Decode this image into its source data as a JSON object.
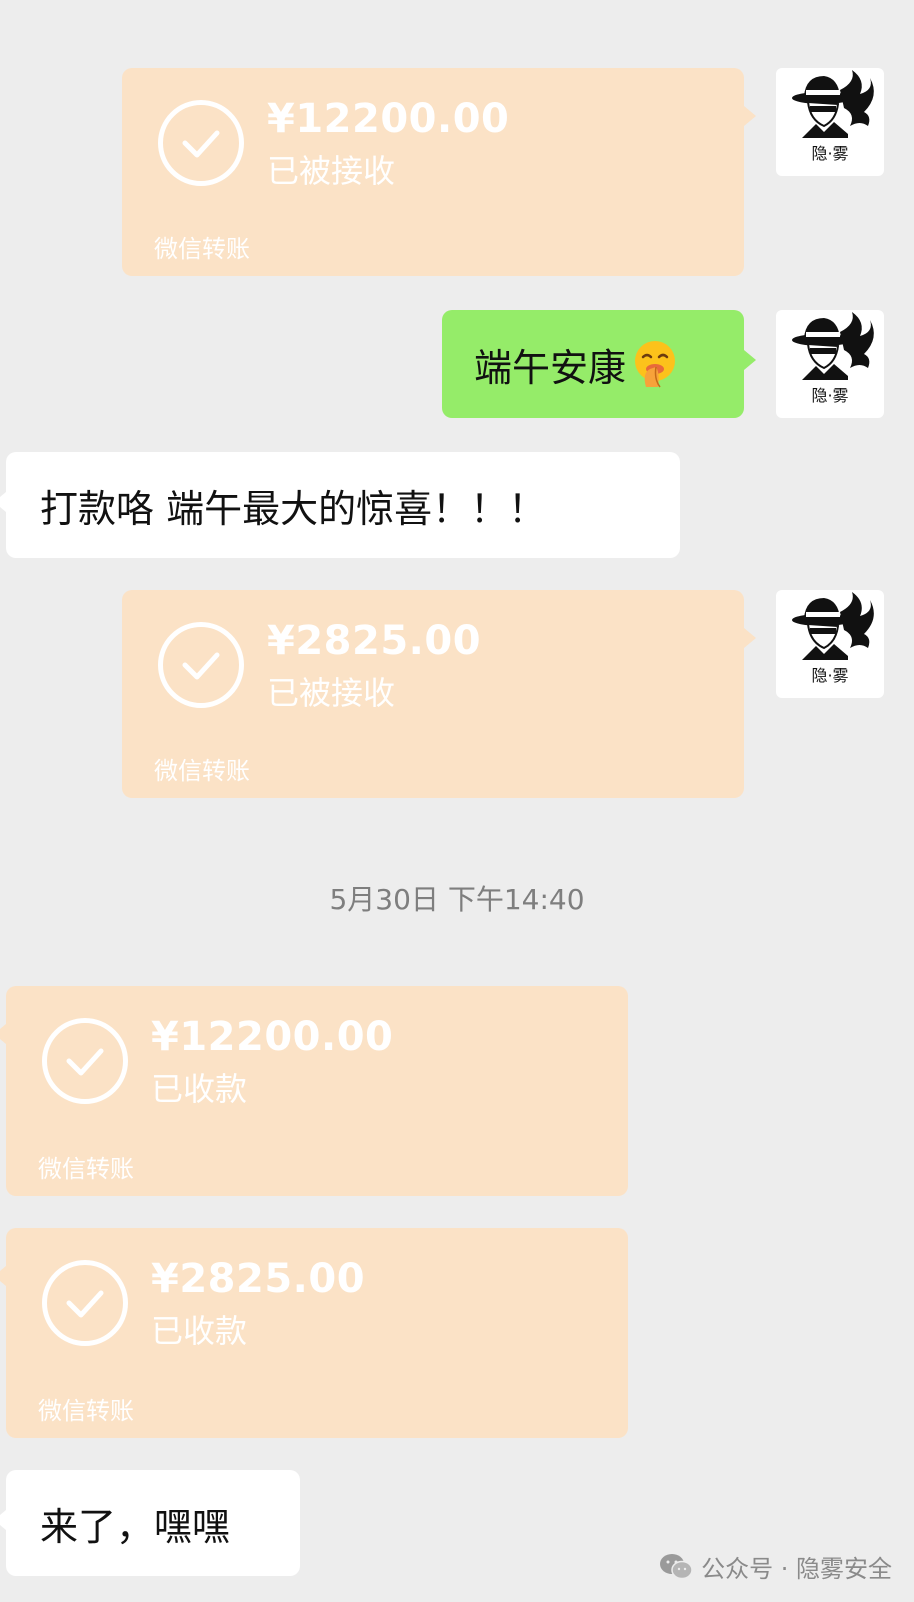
{
  "messages": {
    "transfer_out_1": {
      "amount": "¥12200.00",
      "status": "已被接收",
      "label": "微信转账"
    },
    "greeting": {
      "text": "端午安康"
    },
    "incoming_text_1": {
      "text": "打款咯 端午最大的惊喜！！！"
    },
    "transfer_out_2": {
      "amount": "¥2825.00",
      "status": "已被接收",
      "label": "微信转账"
    },
    "timestamp": "5月30日 下午14:40",
    "transfer_in_1": {
      "amount": "¥12200.00",
      "status": "已收款",
      "label": "微信转账"
    },
    "transfer_in_2": {
      "amount": "¥2825.00",
      "status": "已收款",
      "label": "微信转账"
    },
    "incoming_text_2": {
      "text": "来了，嘿嘿"
    }
  },
  "avatar": {
    "brand": "隐·雾",
    "icon": "spy-hat-avatar-icon"
  },
  "emoji": {
    "icon": "shushing-face-emoji"
  },
  "watermark": {
    "text": "公众号 · 隐雾安全",
    "icon": "wechat-icon"
  },
  "colors": {
    "background": "#ededed",
    "transfer_card": "#fbe2c6",
    "sent_bubble": "#95ec69",
    "received_bubble": "#ffffff"
  }
}
